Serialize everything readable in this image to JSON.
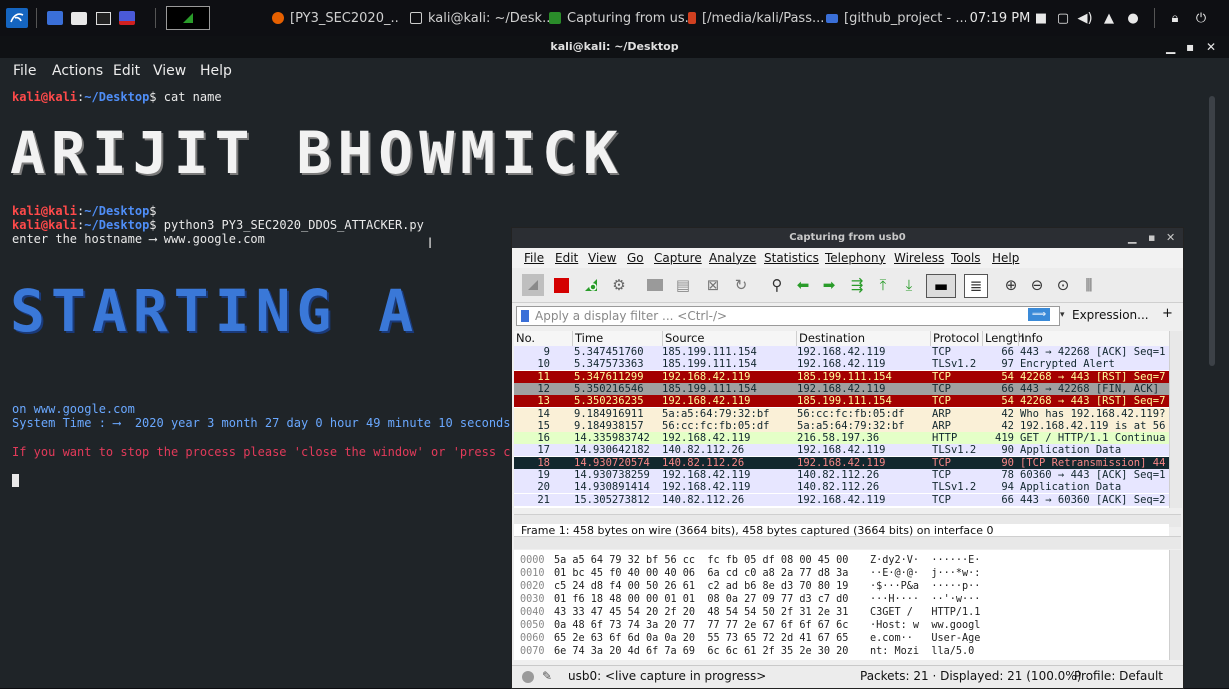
{
  "taskbar": {
    "tasks": [
      {
        "label": "[PY3_SEC2020_...",
        "icon": "firefox-icon",
        "color": "#e66000"
      },
      {
        "label": "kali@kali: ~/Desk...",
        "icon": "terminal-icon",
        "color": "#cccccc"
      },
      {
        "label": "Capturing from us...",
        "icon": "wireshark-icon",
        "color": "#2a8c2a"
      },
      {
        "label": "[/media/kali/Pass...",
        "icon": "editor-icon",
        "color": "#d04020"
      },
      {
        "label": "[github_project - ...",
        "icon": "folder-icon",
        "color": "#3a6fd8"
      }
    ],
    "clock": "07:19 PM"
  },
  "terminal": {
    "title": "kali@kali: ~/Desktop",
    "menu": [
      "File",
      "Actions",
      "Edit",
      "View",
      "Help"
    ],
    "prompt_user": "kali@kali",
    "prompt_path": "~/Desktop",
    "cmd1": "cat name",
    "banner_name": "ARIJIT BHOWMICK",
    "cmd2": "python3 PY3_SEC2020_DDOS_ATTACKER.py",
    "hostname_line": "enter the hostname ⟶ www.google.com",
    "banner_starting": "STARTING A",
    "on_host": "on www.google.com",
    "system_time": "System Time : ⟶  2020 year 3 month 27 day 0 hour 49 minute 10 seconds",
    "stop_msg": "If you want to stop the process please 'close the window' or 'press ct"
  },
  "wireshark": {
    "title": "Capturing from usb0",
    "menu": [
      "File",
      "Edit",
      "View",
      "Go",
      "Capture",
      "Analyze",
      "Statistics",
      "Telephony",
      "Wireless",
      "Tools",
      "Help"
    ],
    "filter_placeholder": "Apply a display filter ... <Ctrl-/>",
    "expression_label": "Expression...",
    "plus_label": "+",
    "columns": [
      "No.",
      "Time",
      "Source",
      "Destination",
      "Protocol",
      "Length",
      "Info"
    ],
    "packets": [
      {
        "no": "9",
        "time": "5.347451760",
        "src": "185.199.111.154",
        "dst": "192.168.42.119",
        "proto": "TCP",
        "len": "66",
        "info": "443 → 42268 [ACK] Seq=1",
        "bg": "#e7e6ff",
        "fg": "#12272e"
      },
      {
        "no": "10",
        "time": "5.347573363",
        "src": "185.199.111.154",
        "dst": "192.168.42.119",
        "proto": "TLSv1.2",
        "len": "97",
        "info": "Encrypted Alert",
        "bg": "#e7e6ff",
        "fg": "#12272e"
      },
      {
        "no": "11",
        "time": "5.347611299",
        "src": "192.168.42.119",
        "dst": "185.199.111.154",
        "proto": "TCP",
        "len": "54",
        "info": "42268 → 443 [RST] Seq=7",
        "bg": "#a40000",
        "fg": "#fffc9c"
      },
      {
        "no": "12",
        "time": "5.350216546",
        "src": "185.199.111.154",
        "dst": "192.168.42.119",
        "proto": "TCP",
        "len": "66",
        "info": "443 → 42268 [FIN, ACK]",
        "bg": "#a0a0a0",
        "fg": "#12272e"
      },
      {
        "no": "13",
        "time": "5.350236235",
        "src": "192.168.42.119",
        "dst": "185.199.111.154",
        "proto": "TCP",
        "len": "54",
        "info": "42268 → 443 [RST] Seq=7",
        "bg": "#a40000",
        "fg": "#fffc9c"
      },
      {
        "no": "14",
        "time": "9.184916911",
        "src": "5a:a5:64:79:32:bf",
        "dst": "56:cc:fc:fb:05:df",
        "proto": "ARP",
        "len": "42",
        "info": "Who has 192.168.42.119?",
        "bg": "#faf0d7",
        "fg": "#12272e"
      },
      {
        "no": "15",
        "time": "9.184938157",
        "src": "56:cc:fc:fb:05:df",
        "dst": "5a:a5:64:79:32:bf",
        "proto": "ARP",
        "len": "42",
        "info": "192.168.42.119 is at 56",
        "bg": "#faf0d7",
        "fg": "#12272e"
      },
      {
        "no": "16",
        "time": "14.335983742",
        "src": "192.168.42.119",
        "dst": "216.58.197.36",
        "proto": "HTTP",
        "len": "419",
        "info": "GET / HTTP/1.1 Continua",
        "bg": "#e4ffc7",
        "fg": "#12272e"
      },
      {
        "no": "17",
        "time": "14.930642182",
        "src": "140.82.112.26",
        "dst": "192.168.42.119",
        "proto": "TLSv1.2",
        "len": "90",
        "info": "Application Data",
        "bg": "#e7e6ff",
        "fg": "#12272e"
      },
      {
        "no": "18",
        "time": "14.930720574",
        "src": "140.82.112.26",
        "dst": "192.168.42.119",
        "proto": "TCP",
        "len": "90",
        "info": "[TCP Retransmission] 44",
        "bg": "#12272e",
        "fg": "#f78787"
      },
      {
        "no": "19",
        "time": "14.930738259",
        "src": "192.168.42.119",
        "dst": "140.82.112.26",
        "proto": "TCP",
        "len": "78",
        "info": "60360 → 443 [ACK] Seq=1",
        "bg": "#e7e6ff",
        "fg": "#12272e"
      },
      {
        "no": "20",
        "time": "14.930891414",
        "src": "192.168.42.119",
        "dst": "140.82.112.26",
        "proto": "TLSv1.2",
        "len": "94",
        "info": "Application Data",
        "bg": "#e7e6ff",
        "fg": "#12272e"
      },
      {
        "no": "21",
        "time": "15.305273812",
        "src": "140.82.112.26",
        "dst": "192.168.42.119",
        "proto": "TCP",
        "len": "66",
        "info": "443 → 60360 [ACK] Seq=2",
        "bg": "#e7e6ff",
        "fg": "#12272e"
      }
    ],
    "detail_line": "  Frame 1: 458 bytes on wire (3664 bits), 458 bytes captured (3664 bits) on interface 0",
    "hex_rows": [
      {
        "off": "0000",
        "hex": "5a a5 64 79 32 bf 56 cc  fc fb 05 df 08 00 45 00",
        "ascii": "Z·dy2·V·  ······E·"
      },
      {
        "off": "0010",
        "hex": "01 bc 45 f0 40 00 40 06  6a cd c0 a8 2a 77 d8 3a",
        "ascii": "··E·@·@·  j···*w·:"
      },
      {
        "off": "0020",
        "hex": "c5 24 d8 f4 00 50 26 61  c2 ad b6 8e d3 70 80 19",
        "ascii": "·$···P&a  ·····p··"
      },
      {
        "off": "0030",
        "hex": "01 f6 18 48 00 00 01 01  08 0a 27 09 77 d3 c7 d0",
        "ascii": "···H····  ··'·w···"
      },
      {
        "off": "0040",
        "hex": "43 33 47 45 54 20 2f 20  48 54 54 50 2f 31 2e 31",
        "ascii": "C3GET /   HTTP/1.1"
      },
      {
        "off": "0050",
        "hex": "0a 48 6f 73 74 3a 20 77  77 77 2e 67 6f 6f 67 6c",
        "ascii": "·Host: w  ww.googl"
      },
      {
        "off": "0060",
        "hex": "65 2e 63 6f 6d 0a 0a 20  55 73 65 72 2d 41 67 65",
        "ascii": "e.com··   User-Age"
      },
      {
        "off": "0070",
        "hex": "6e 74 3a 20 4d 6f 7a 69  6c 6c 61 2f 35 2e 30 20",
        "ascii": "nt: Mozi  lla/5.0 "
      }
    ],
    "status": {
      "capture": "usb0: <live capture in progress>",
      "packets": "Packets: 21 · Displayed: 21 (100.0%)",
      "profile": "Profile: Default"
    }
  }
}
